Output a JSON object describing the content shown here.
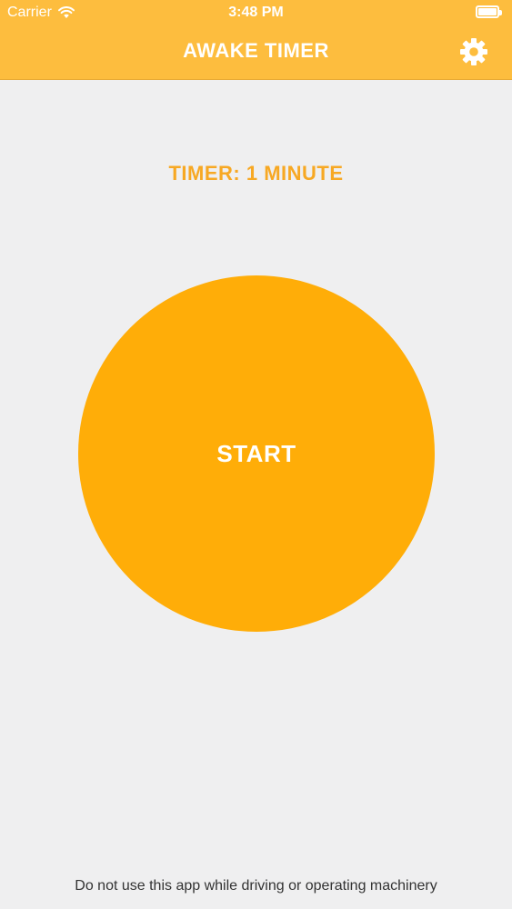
{
  "status_bar": {
    "carrier": "Carrier",
    "time": "3:48 PM",
    "wifi_icon": "wifi-icon",
    "battery_icon": "battery-icon"
  },
  "header": {
    "title": "AWAKE TIMER",
    "settings_icon": "gear-icon"
  },
  "timer": {
    "label": "TIMER: 1 MINUTE"
  },
  "start_button": {
    "label": "START"
  },
  "footer": {
    "disclaimer": "Do not use this app while driving or operating machinery"
  },
  "colors": {
    "header_bg": "#fdbd3e",
    "accent": "#ffad08",
    "timer_text": "#f7a823",
    "background": "#efeff0"
  }
}
